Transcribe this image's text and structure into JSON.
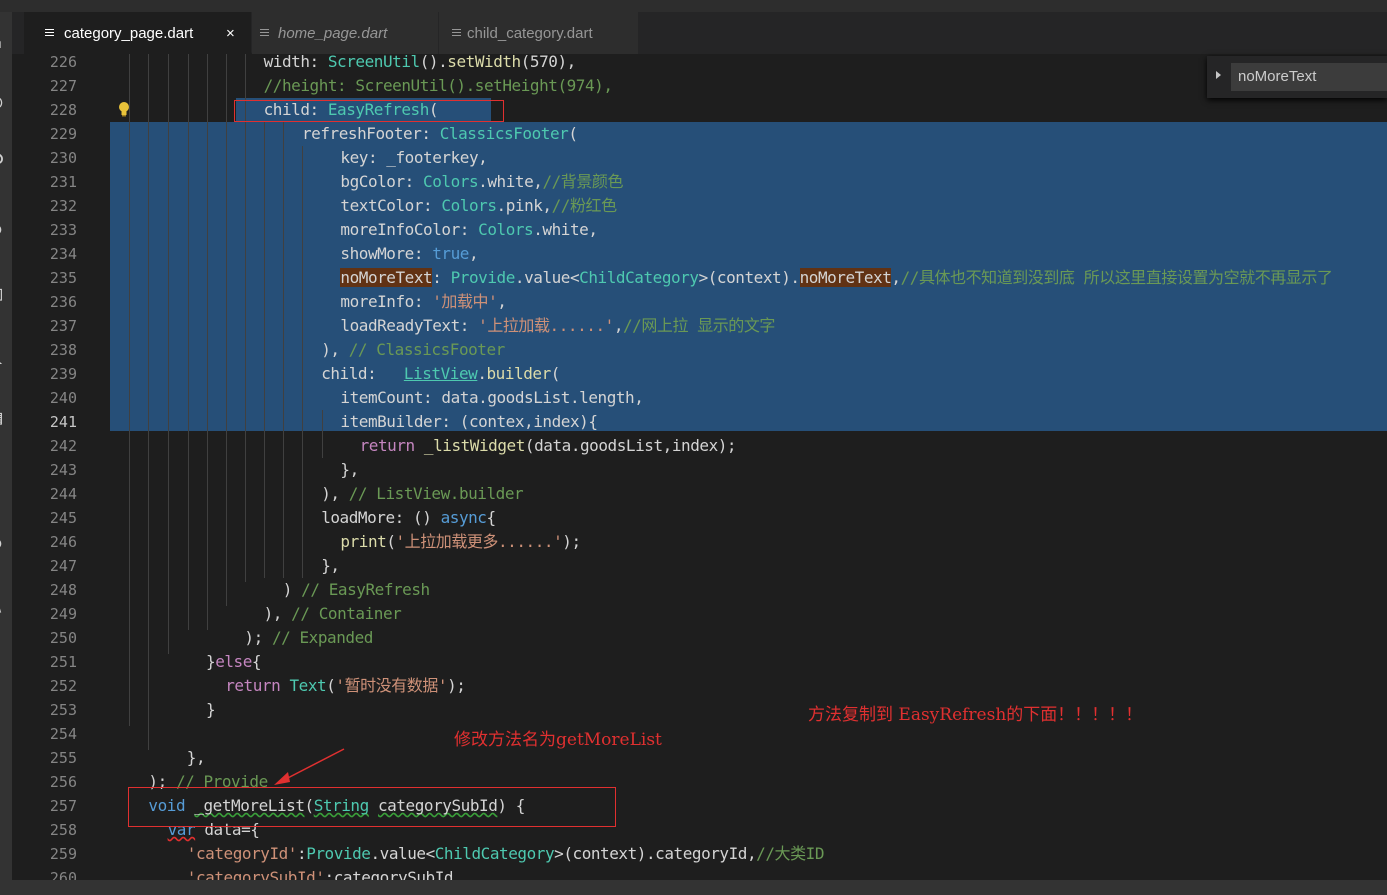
{
  "tabs": [
    {
      "label": "category_page.dart",
      "active": true,
      "close": "×"
    },
    {
      "label": "home_page.dart",
      "active": false
    },
    {
      "label": "child_category.dart",
      "active": false
    }
  ],
  "find_widget": {
    "value": "noMoreText"
  },
  "lines": [
    {
      "n": "226",
      "code": "width: ScreenUtil().setWidth(570),"
    },
    {
      "n": "227",
      "code": "//height: ScreenUtil().setHeight(974),"
    },
    {
      "n": "228",
      "code": "child: EasyRefresh("
    },
    {
      "n": "229",
      "code": "refreshFooter: ClassicsFooter("
    },
    {
      "n": "230",
      "code": "key: _footerkey,"
    },
    {
      "n": "231",
      "code": "bgColor: Colors.white,//背景颜色"
    },
    {
      "n": "232",
      "code": "textColor: Colors.pink,//粉红色"
    },
    {
      "n": "233",
      "code": "moreInfoColor: Colors.white,"
    },
    {
      "n": "234",
      "code": "showMore: true,"
    },
    {
      "n": "235",
      "code": "noMoreText: Provide.value<ChildCategory>(context).noMoreText,//具体也不知道到没到底 所以这里直接设置为空就不再显示了"
    },
    {
      "n": "236",
      "code": "moreInfo: '加载中',"
    },
    {
      "n": "237",
      "code": "loadReadyText: '上拉加载......',//网上拉 显示的文字"
    },
    {
      "n": "238",
      "code": "), // ClassicsFooter"
    },
    {
      "n": "239",
      "code": "child:   ListView.builder("
    },
    {
      "n": "240",
      "code": "itemCount: data.goodsList.length,"
    },
    {
      "n": "241",
      "code": "itemBuilder: (contex,index){"
    },
    {
      "n": "242",
      "code": "return _listWidget(data.goodsList,index);"
    },
    {
      "n": "243",
      "code": "},"
    },
    {
      "n": "244",
      "code": "), // ListView.builder"
    },
    {
      "n": "245",
      "code": "loadMore: () async{"
    },
    {
      "n": "246",
      "code": "print('上拉加载更多......');"
    },
    {
      "n": "247",
      "code": "},"
    },
    {
      "n": "248",
      "code": ") // EasyRefresh"
    },
    {
      "n": "249",
      "code": "), // Container"
    },
    {
      "n": "250",
      "code": "); // Expanded"
    },
    {
      "n": "251",
      "code": "}else{"
    },
    {
      "n": "252",
      "code": "return Text('暂时没有数据');"
    },
    {
      "n": "253",
      "code": "}"
    },
    {
      "n": "254",
      "code": ""
    },
    {
      "n": "255",
      "code": "},"
    },
    {
      "n": "256",
      "code": "); // Provide"
    },
    {
      "n": "257",
      "code": "void _getMoreList(String categorySubId) {"
    },
    {
      "n": "258",
      "code": "var data={"
    },
    {
      "n": "259",
      "code": "'categoryId':Provide.value<ChildCategory>(context).categoryId,//大类ID"
    },
    {
      "n": "260",
      "code": "'categorySubId':categorySubId,"
    }
  ],
  "annotations": {
    "rename": "修改方法名为getMoreList",
    "copy": "方法复制到 EasyRefresh的下面！！！！！"
  },
  "colors": {
    "selection": "#264f78",
    "annotation_red": "#e03030",
    "keyword": "#569cd6",
    "type": "#4ec9b0",
    "string": "#ce9178",
    "comment": "#6a9955"
  }
}
